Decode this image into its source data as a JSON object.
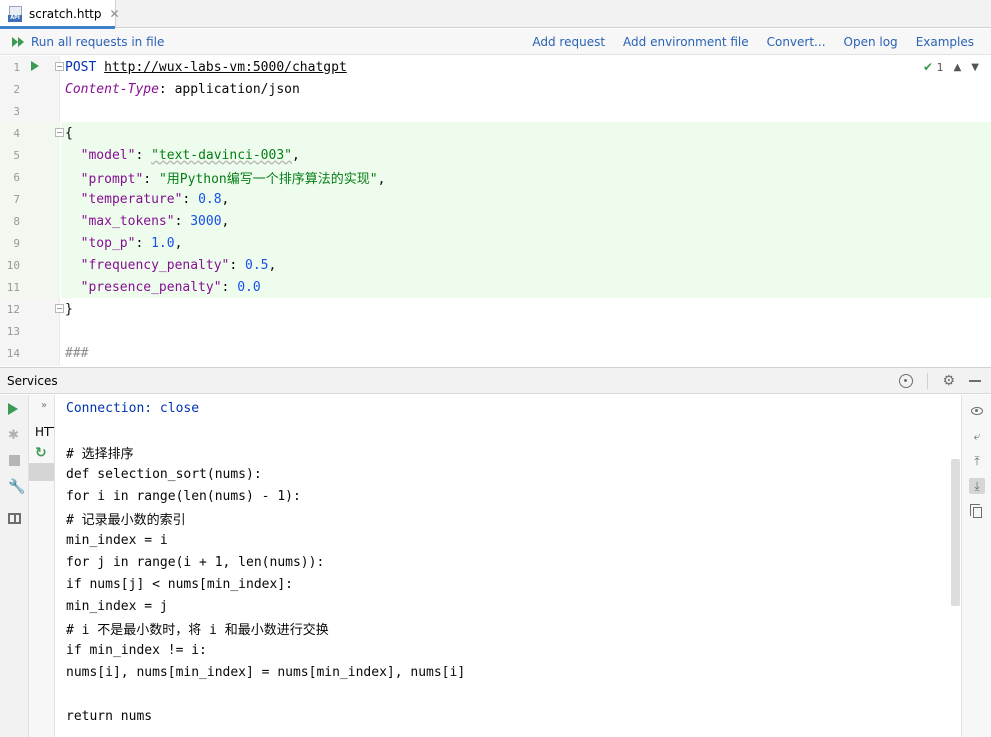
{
  "tab": {
    "label": "scratch.http",
    "icon": "api-file-icon",
    "close_glyph": "✕"
  },
  "toolbar": {
    "run_all_label": "Run all requests in file",
    "add_request": "Add request",
    "add_environment_file": "Add environment file",
    "convert": "Convert...",
    "open_log": "Open log",
    "examples": "Examples"
  },
  "editor": {
    "inspection_count": "1",
    "lines": [
      {
        "n": "1"
      },
      {
        "n": "2"
      },
      {
        "n": "3"
      },
      {
        "n": "4"
      },
      {
        "n": "5"
      },
      {
        "n": "6"
      },
      {
        "n": "7"
      },
      {
        "n": "8"
      },
      {
        "n": "9"
      },
      {
        "n": "10"
      },
      {
        "n": "11"
      },
      {
        "n": "12"
      },
      {
        "n": "13"
      },
      {
        "n": "14"
      }
    ],
    "request": {
      "method": "POST",
      "url": "http://wux-labs-vm:5000/chatgpt",
      "header_name": "Content-Type",
      "header_value": "application/json",
      "open_brace": "{",
      "close_brace": "}",
      "separator": "###"
    },
    "body": [
      {
        "key": "\"model\"",
        "value": "\"text-davinci-003\"",
        "type": "str",
        "comma": ","
      },
      {
        "key": "\"prompt\"",
        "value": "\"用Python编写一个排序算法的实现\"",
        "type": "str",
        "comma": ","
      },
      {
        "key": "\"temperature\"",
        "value": "0.8",
        "type": "num",
        "comma": ","
      },
      {
        "key": "\"max_tokens\"",
        "value": "3000",
        "type": "num",
        "comma": ","
      },
      {
        "key": "\"top_p\"",
        "value": "1.0",
        "type": "num",
        "comma": ","
      },
      {
        "key": "\"frequency_penalty\"",
        "value": "0.5",
        "type": "num",
        "comma": ","
      },
      {
        "key": "\"presence_penalty\"",
        "value": "0.0",
        "type": "num",
        "comma": ""
      }
    ]
  },
  "services": {
    "title": "Services",
    "tree_item": "HTT",
    "output": [
      "Connection: close",
      "",
      "# 选择排序",
      "def selection_sort(nums):",
      "for i in range(len(nums) - 1):",
      "# 记录最小数的索引",
      "min_index = i",
      "for j in range(i + 1, len(nums)):",
      "if nums[j] < nums[min_index]:",
      "min_index = j",
      "# i 不是最小数时，将 i 和最小数进行交换",
      "if min_index != i:",
      "nums[i], nums[min_index] = nums[min_index], nums[i]",
      "",
      "return nums"
    ]
  },
  "colors": {
    "accent": "#2a62b5",
    "run_green": "#3c9a54",
    "highlight": "#edfcec"
  }
}
